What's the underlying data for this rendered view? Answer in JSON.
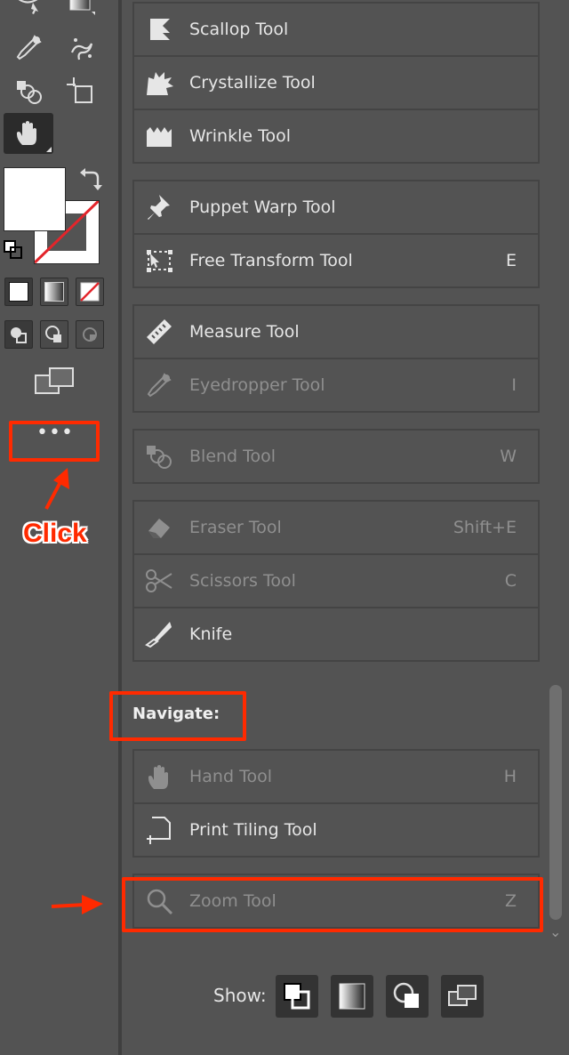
{
  "toolbar": {
    "icons": [
      "lasso-icon",
      "gradient-icon",
      "eyedropper-icon",
      "symbol-sprayer-icon",
      "shape-builder-icon",
      "artboard-icon",
      "hand-icon"
    ],
    "more_button_label": "•••",
    "annotation_click_label": "Click"
  },
  "panel": {
    "groups": [
      [
        {
          "name": "scallop",
          "label": "Scallop Tool",
          "shortcut": "",
          "disabled": false,
          "icon": "scallop-icon"
        },
        {
          "name": "crystallize",
          "label": "Crystallize Tool",
          "shortcut": "",
          "disabled": false,
          "icon": "crystallize-icon"
        },
        {
          "name": "wrinkle",
          "label": "Wrinkle Tool",
          "shortcut": "",
          "disabled": false,
          "icon": "wrinkle-icon"
        }
      ],
      [
        {
          "name": "puppet-warp",
          "label": "Puppet Warp Tool",
          "shortcut": "",
          "disabled": false,
          "icon": "pin-icon"
        },
        {
          "name": "free-transform",
          "label": "Free Transform Tool",
          "shortcut": "E",
          "disabled": false,
          "icon": "free-transform-icon"
        }
      ],
      [
        {
          "name": "measure",
          "label": "Measure Tool",
          "shortcut": "",
          "disabled": false,
          "icon": "ruler-icon"
        },
        {
          "name": "eyedropper",
          "label": "Eyedropper Tool",
          "shortcut": "I",
          "disabled": true,
          "icon": "eyedropper-icon"
        }
      ],
      [
        {
          "name": "blend",
          "label": "Blend Tool",
          "shortcut": "W",
          "disabled": true,
          "icon": "blend-icon"
        }
      ],
      [
        {
          "name": "eraser",
          "label": "Eraser Tool",
          "shortcut": "Shift+E",
          "disabled": true,
          "icon": "eraser-icon"
        },
        {
          "name": "scissors",
          "label": "Scissors Tool",
          "shortcut": "C",
          "disabled": true,
          "icon": "scissors-icon"
        },
        {
          "name": "knife",
          "label": "Knife",
          "shortcut": "",
          "disabled": false,
          "icon": "knife-icon"
        }
      ],
      [
        {
          "name": "hand",
          "label": "Hand Tool",
          "shortcut": "H",
          "disabled": true,
          "icon": "hand-icon"
        },
        {
          "name": "print-tiling",
          "label": "Print Tiling Tool",
          "shortcut": "",
          "disabled": false,
          "icon": "print-tiling-icon"
        }
      ],
      [
        {
          "name": "zoom",
          "label": "Zoom Tool",
          "shortcut": "Z",
          "disabled": true,
          "icon": "zoom-icon"
        }
      ]
    ],
    "section_navigate": "Navigate:",
    "show_label": "Show:",
    "show_buttons": [
      "fill-stroke-show-icon",
      "gradient-show-icon",
      "draw-modes-show-icon",
      "screen-modes-show-icon"
    ]
  },
  "colors": {
    "annotation_red": "#ff2a00",
    "panel_bg": "#535353",
    "disabled_text": "#8f8f8f"
  }
}
